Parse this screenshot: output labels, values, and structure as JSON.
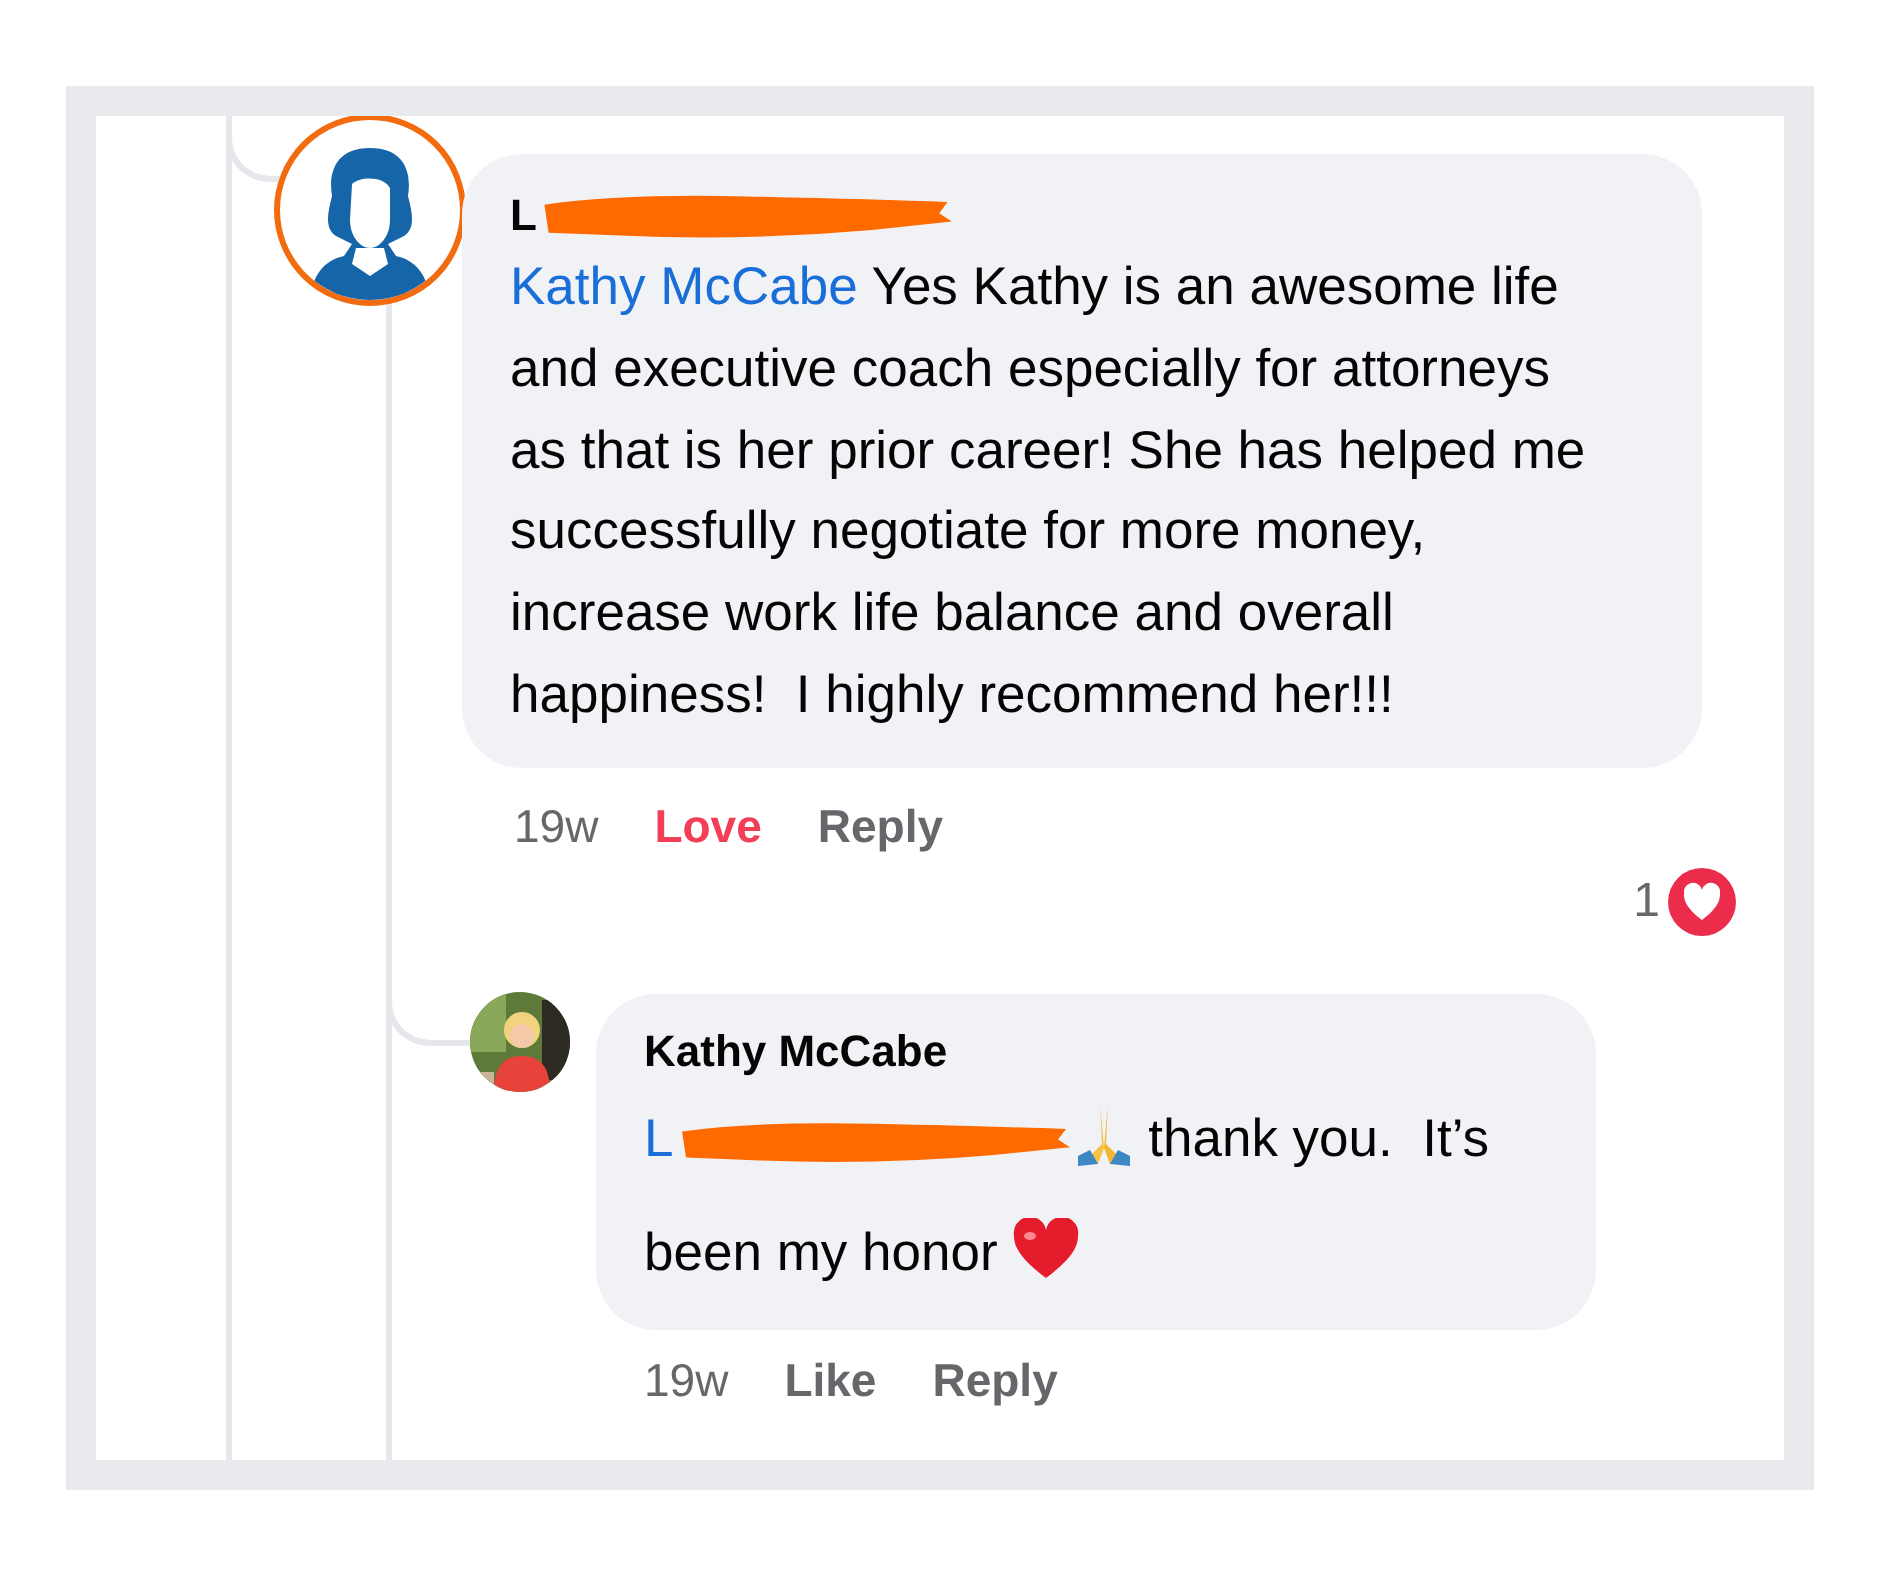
{
  "comments": [
    {
      "avatar": {
        "kind": "silhouette"
      },
      "author": "L",
      "author_redacted": true,
      "body": [
        {
          "kind": "mention",
          "text": "Kathy McCabe"
        },
        {
          "kind": "text",
          "text": " Yes Kathy is an awesome life and executive coach especially for attorneys as that is her prior career! She has helped me successfully negotiate for more money, increase work life balance and overall happiness!  I highly recommend her!!!"
        }
      ],
      "time": "19w",
      "actions": [
        {
          "label": "Love",
          "selected": true
        },
        {
          "label": "Reply",
          "selected": false
        }
      ],
      "reaction_count": "1",
      "replies": [
        {
          "author": "Kathy McCabe",
          "author_redacted": false,
          "body": [
            {
              "kind": "mention",
              "text": "L"
            },
            {
              "kind": "redaction"
            },
            {
              "kind": "pray-emoji"
            },
            {
              "kind": "text",
              "text": " thank you.  It’s been my honor "
            },
            {
              "kind": "heart-emoji"
            }
          ],
          "time": "19w",
          "actions": [
            {
              "label": "Like",
              "selected": false
            },
            {
              "label": "Reply",
              "selected": false
            }
          ]
        }
      ]
    }
  ]
}
